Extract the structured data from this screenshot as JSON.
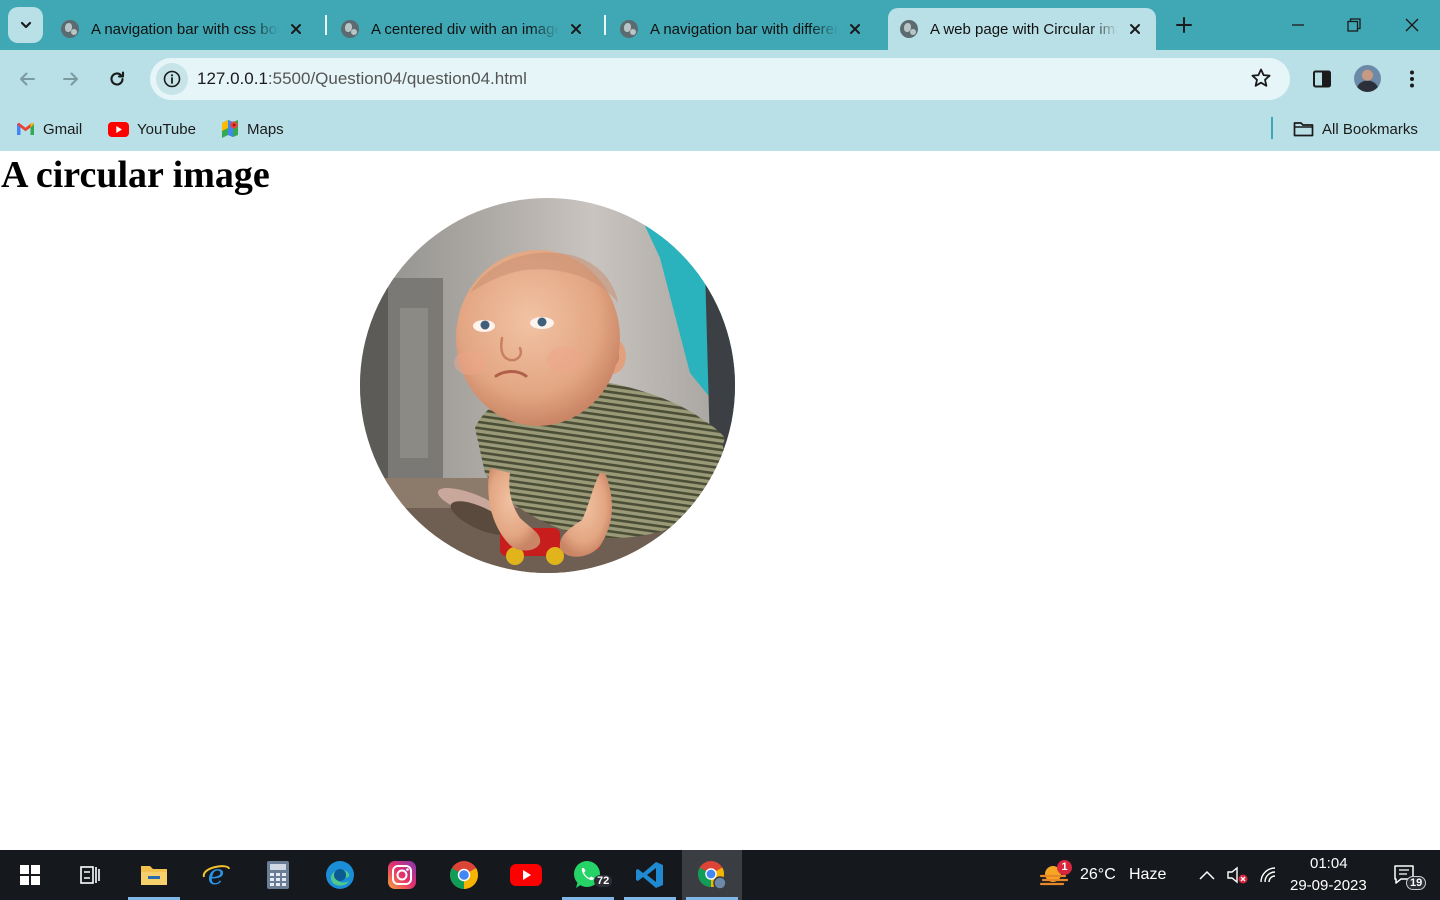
{
  "browser": {
    "tabs": [
      {
        "title": "A navigation bar with css border"
      },
      {
        "title": "A centered div with an image"
      },
      {
        "title": "A navigation bar with different colors"
      },
      {
        "title": "A web page with Circular image"
      }
    ],
    "url": {
      "host": "127.0.0.1",
      "path": ":5500/Question04/question04.html"
    },
    "bookmarks": [
      {
        "label": "Gmail"
      },
      {
        "label": "YouTube"
      },
      {
        "label": "Maps"
      }
    ],
    "all_bookmarks_label": "All Bookmarks"
  },
  "page": {
    "heading": "A circular image"
  },
  "taskbar": {
    "weather_temp": "26°C",
    "weather_desc": "Haze",
    "weather_badge": "1",
    "whatsapp_badge": "72",
    "time": "01:04",
    "date": "29-09-2023",
    "notifications_count": "19"
  },
  "colors": {
    "tab_strip": "#3fa8b4",
    "toolbar": "#b9e0e6",
    "taskbar": "#15181c"
  }
}
